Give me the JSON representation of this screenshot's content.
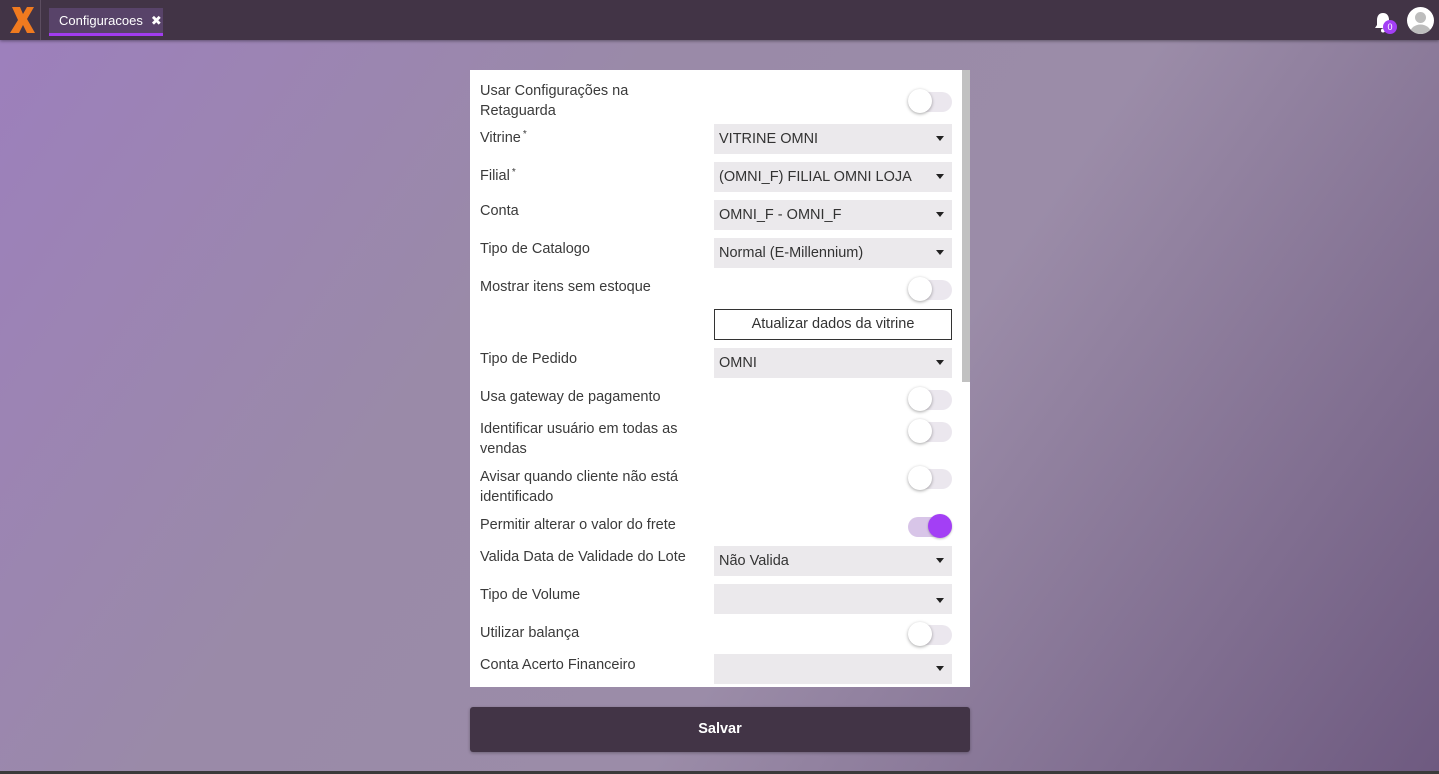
{
  "header": {
    "tab_label": "Configuracoes",
    "tab_close": "✖",
    "notifications_count": "0",
    "colors": {
      "bar": "#423446",
      "accent": "#a33ff5"
    }
  },
  "form": {
    "usar_config": {
      "label": "Usar Configurações na Retaguarda",
      "checked": false
    },
    "vitrine": {
      "label": "Vitrine",
      "required": "*",
      "value": "VITRINE OMNI"
    },
    "filial": {
      "label": "Filial",
      "required": "*",
      "value": "(OMNI_F) FILIAL OMNI LOJA"
    },
    "conta": {
      "label": "Conta",
      "value": "OMNI_F - OMNI_F"
    },
    "tipo_catalogo": {
      "label": "Tipo de Catalogo",
      "value": "Normal (E-Millennium)"
    },
    "mostrar_itens": {
      "label": "Mostrar itens sem estoque",
      "checked": false
    },
    "atualizar_button": "Atualizar dados da vitrine",
    "tipo_pedido": {
      "label": "Tipo de Pedido",
      "value": "OMNI"
    },
    "gateway": {
      "label": "Usa gateway de pagamento",
      "checked": false
    },
    "identificar": {
      "label": "Identificar usuário em todas as vendas",
      "checked": false
    },
    "avisar": {
      "label": "Avisar quando cliente não está identificado",
      "checked": false
    },
    "frete": {
      "label": "Permitir alterar o valor do frete",
      "checked": true
    },
    "valida_lote": {
      "label": "Valida Data de Validade do Lote",
      "value": "Não Valida"
    },
    "tipo_volume": {
      "label": "Tipo de Volume",
      "value": ""
    },
    "balanca": {
      "label": "Utilizar balança",
      "checked": false
    },
    "conta_acerto": {
      "label": "Conta Acerto Financeiro",
      "value": ""
    }
  },
  "save_label": "Salvar"
}
